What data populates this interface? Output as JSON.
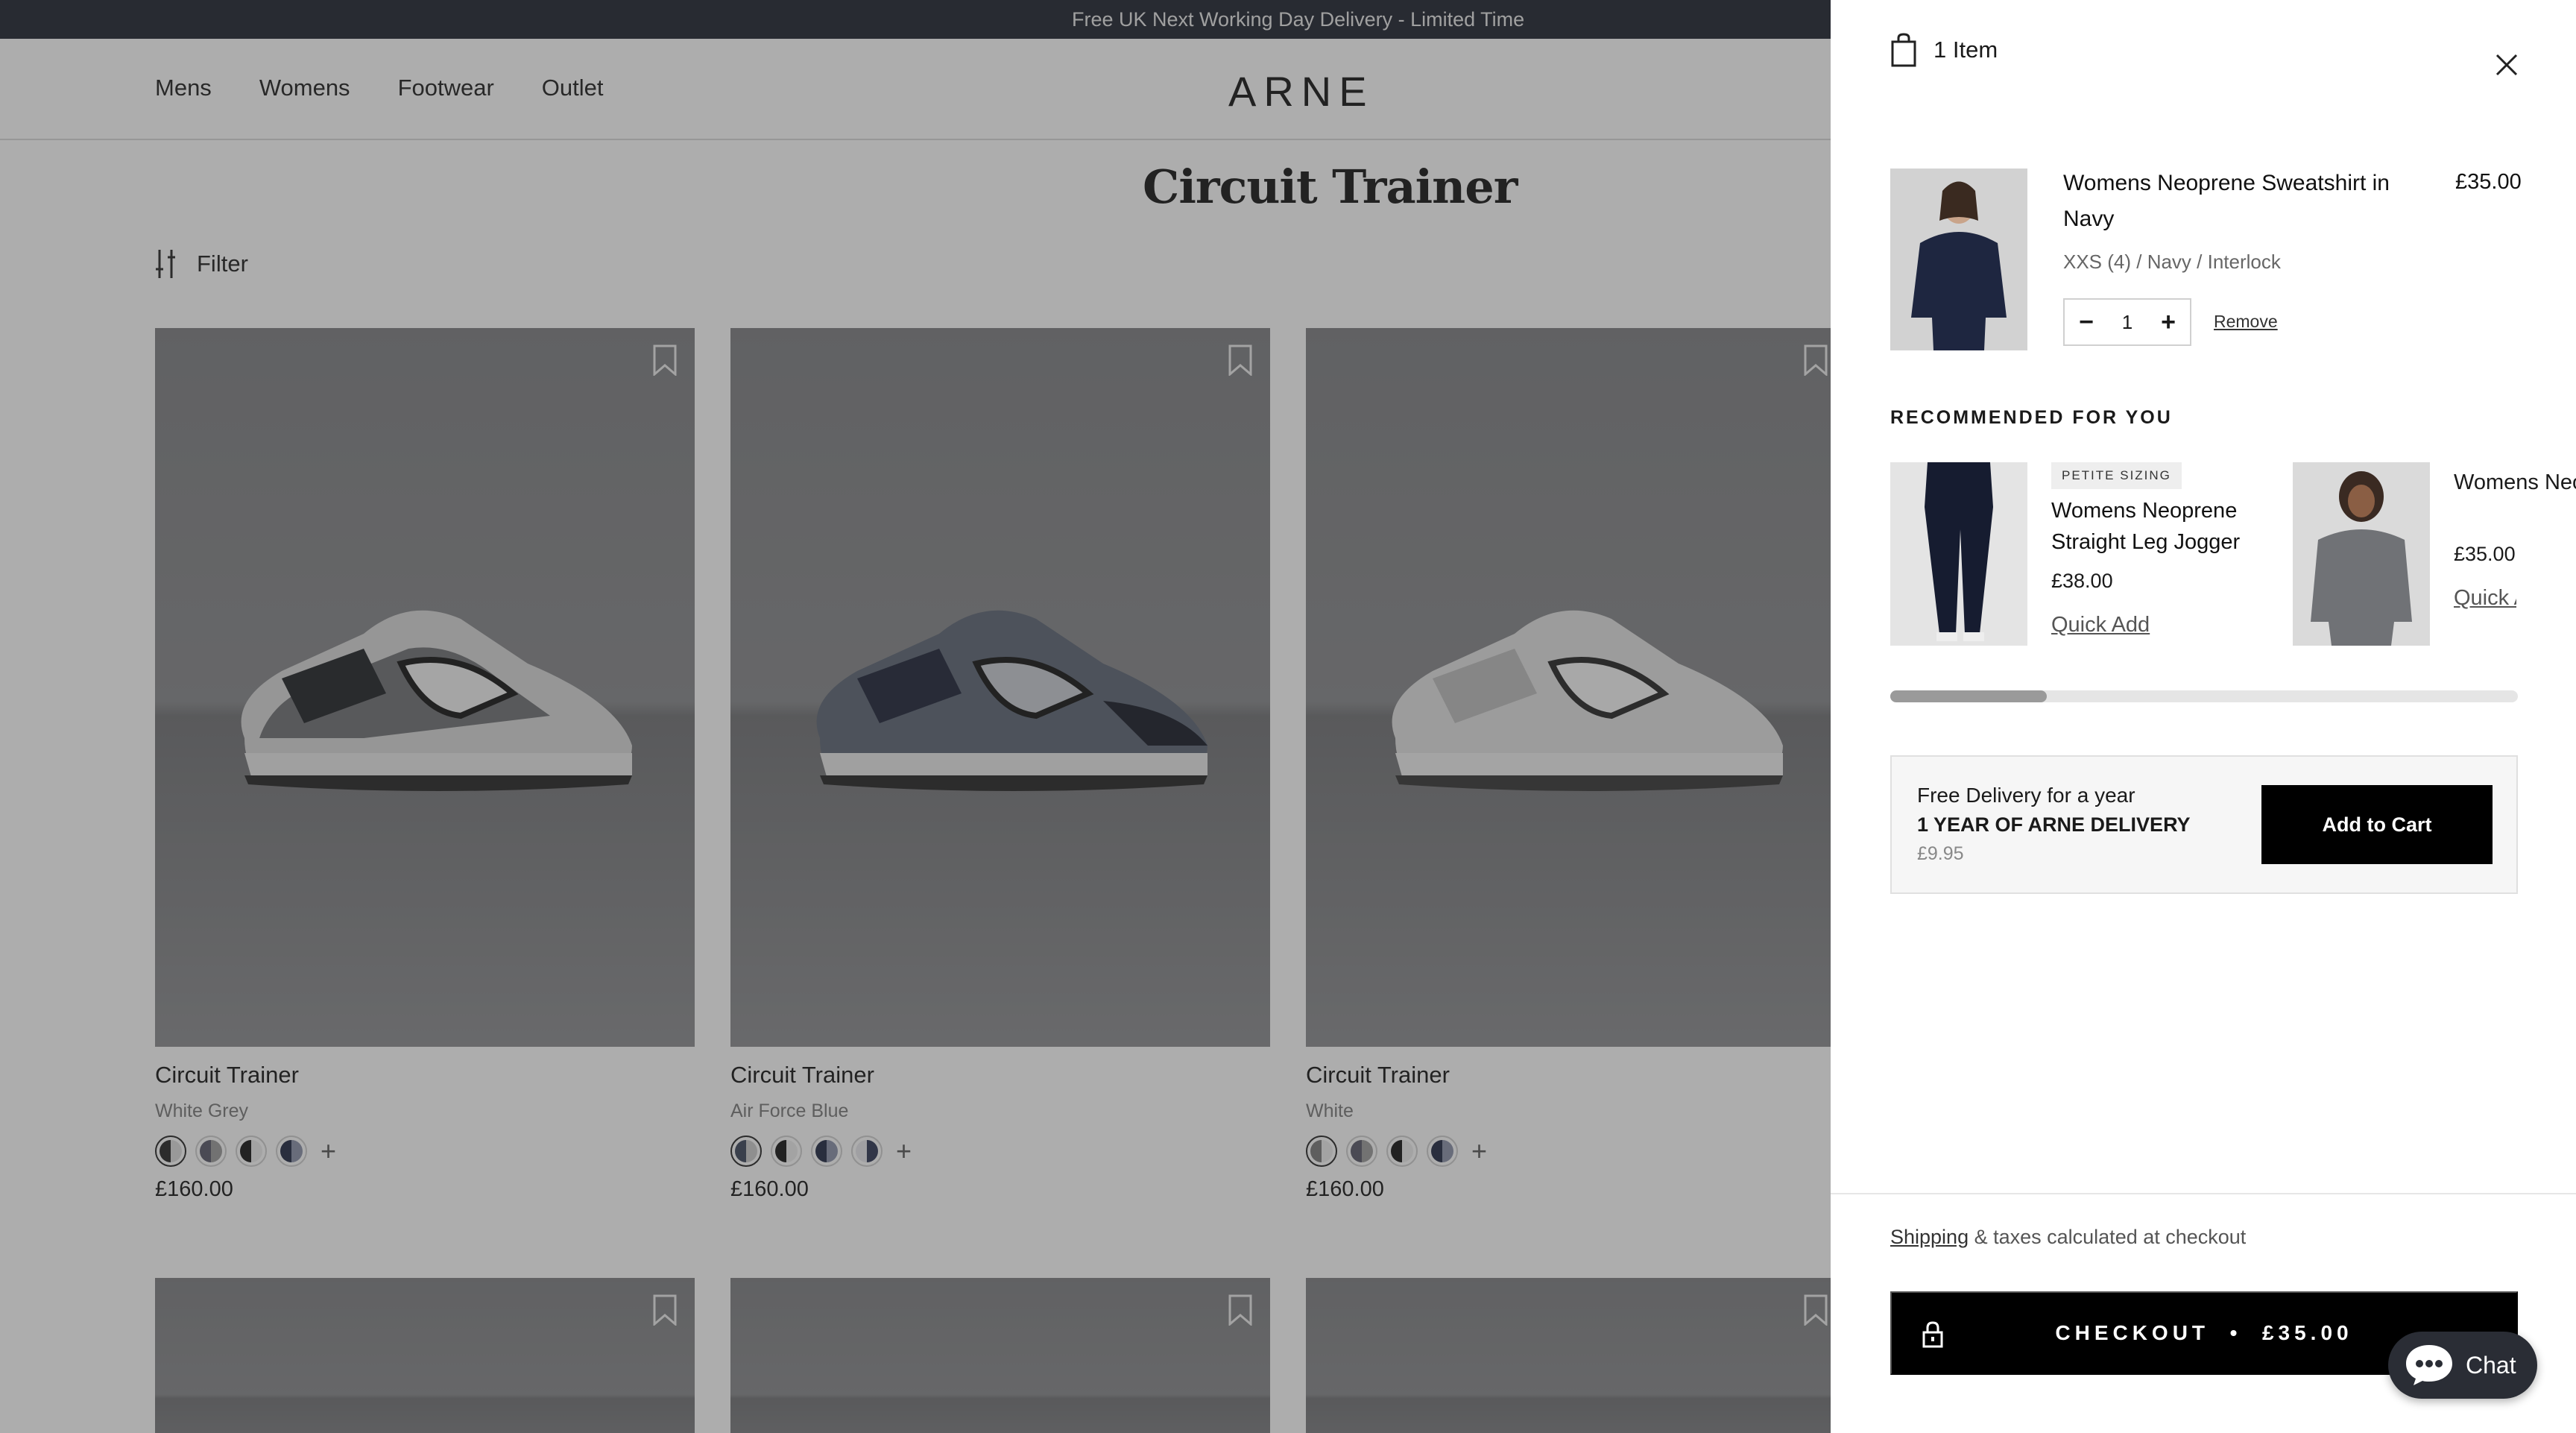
{
  "announcement": "Free UK Next Working Day Delivery - Limited Time",
  "nav": [
    "Mens",
    "Womens",
    "Footwear",
    "Outlet"
  ],
  "logo": "ARNE",
  "page_title": "Circuit Trainer",
  "filter_label": "Filter",
  "products": [
    {
      "name": "Circuit Trainer",
      "color": "White Grey",
      "price": "£160.00"
    },
    {
      "name": "Circuit Trainer",
      "color": "Air Force Blue",
      "price": "£160.00"
    },
    {
      "name": "Circuit Trainer",
      "color": "White",
      "price": "£160.00"
    }
  ],
  "cart": {
    "count_label": "1 Item",
    "line": {
      "title": "Womens Neoprene Sweatshirt in Navy",
      "variant": "XXS (4) / Navy / Interlock",
      "price": "£35.00",
      "qty": "1",
      "remove": "Remove"
    },
    "recommended_title": "RECOMMENDED FOR YOU",
    "recommended": [
      {
        "badge": "PETITE SIZING",
        "name": "Womens Neoprene Straight Leg Jogger",
        "price": "£38.00",
        "quick_add": "Quick Add"
      },
      {
        "name": "Womens Neoprene Sweatshirt",
        "price": "£35.00",
        "quick_add": "Quick Add"
      }
    ],
    "upsell": {
      "line1": "Free Delivery for a year",
      "line2": "1 YEAR OF ARNE DELIVERY",
      "price": "£9.95",
      "button": "Add to Cart"
    },
    "shipping_link": "Shipping",
    "shipping_rest": " & taxes calculated at checkout",
    "checkout": "CHECKOUT  •  £35.00"
  },
  "chat_label": "Chat"
}
